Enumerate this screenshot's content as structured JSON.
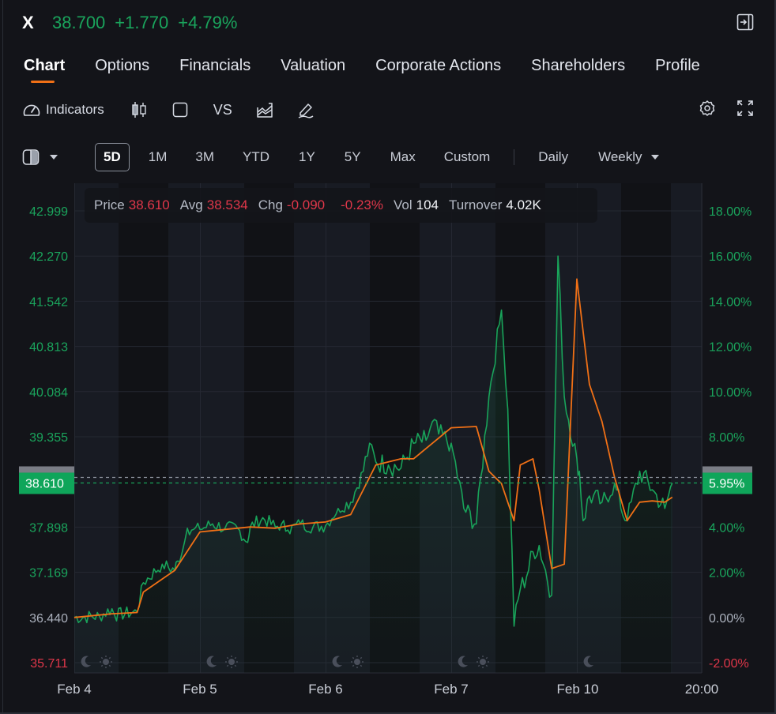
{
  "header": {
    "ticker": "X",
    "price": "38.700",
    "change": "+1.770",
    "change_pct": "+4.79%",
    "quote_color": "#1aa45c"
  },
  "tabs": [
    {
      "label": "Chart",
      "active": true
    },
    {
      "label": "Options",
      "active": false
    },
    {
      "label": "Financials",
      "active": false
    },
    {
      "label": "Valuation",
      "active": false
    },
    {
      "label": "Corporate Actions",
      "active": false
    },
    {
      "label": "Shareholders",
      "active": false
    },
    {
      "label": "Profile",
      "active": false
    }
  ],
  "toolbar": {
    "indicators_label": "Indicators",
    "vs_label": "VS",
    "icons": [
      "gauge-icon",
      "candlestick-icon",
      "square-icon",
      "compare-chart-icon",
      "draw-pen-icon",
      "settings-gear-icon",
      "fullscreen-icon",
      "collapse-panel-icon"
    ]
  },
  "ranges": {
    "items": [
      "5D",
      "1M",
      "3M",
      "YTD",
      "1Y",
      "5Y",
      "Max",
      "Custom"
    ],
    "selected": "5D",
    "interval_daily": "Daily",
    "interval_weekly": "Weekly"
  },
  "info": {
    "price_label": "Price",
    "price": "38.610",
    "avg_label": "Avg",
    "avg": "38.534",
    "chg_label": "Chg",
    "chg": "-0.090",
    "chg_pct": "-0.23%",
    "vol_label": "Vol",
    "vol": "104",
    "turnover_label": "Turnover",
    "turnover": "4.02K"
  },
  "colors": {
    "up": "#1aa45c",
    "down": "#e0374a",
    "neutral": "#aab0bc",
    "price_line": "#19a35a",
    "avg_line": "#f07016",
    "tag_bg": "#0fa55a"
  },
  "chart_data": {
    "type": "line",
    "title": "",
    "xlabel": "",
    "ylabel": "Price",
    "x_ticks": [
      "Feb 4",
      "Feb 5",
      "Feb 6",
      "Feb 7",
      "Feb 10",
      "20:00"
    ],
    "left_axis": {
      "ticks": [
        "42.999",
        "42.270",
        "41.542",
        "40.813",
        "40.084",
        "39.355",
        "37.898",
        "37.169",
        "36.440",
        "35.711"
      ],
      "ylim": [
        35.711,
        42.999
      ],
      "prev_close": 36.44
    },
    "right_axis": {
      "ticks": [
        "18.00%",
        "16.00%",
        "14.00%",
        "12.00%",
        "10.00%",
        "8.00%",
        "4.00%",
        "2.00%",
        "0.00%",
        "-2.00%"
      ],
      "ylim": [
        -2.0,
        18.0
      ]
    },
    "current_price_tag": "38.610",
    "current_pct_tag": "5.95%",
    "grid": true,
    "session_markers": [
      "moon",
      "sun",
      "moon",
      "sun",
      "moon",
      "sun",
      "moon",
      "sun",
      "moon"
    ],
    "series": [
      {
        "name": "Price",
        "x": [
          0,
          0.2,
          0.3,
          0.32,
          0.5,
          0.55,
          0.7,
          0.8,
          0.82,
          0.86,
          0.9,
          0.95,
          1.0,
          1.1,
          1.2,
          1.3,
          1.38,
          1.4,
          1.5,
          1.6,
          1.65,
          1.7,
          1.8,
          1.9,
          2.0,
          2.1,
          2.2,
          2.3,
          2.35,
          2.4,
          2.5,
          2.6,
          2.7,
          2.8,
          2.85,
          2.9,
          3.0,
          3.1,
          3.2,
          3.3,
          3.4,
          3.45,
          3.5,
          3.55,
          3.6,
          3.65,
          3.7,
          3.8,
          3.85,
          3.9,
          4.0,
          4.02,
          4.05,
          4.1,
          4.2,
          4.3,
          4.35,
          4.4,
          4.5,
          4.6,
          4.7,
          4.76
        ],
        "values": [
          36.44,
          36.46,
          36.58,
          36.48,
          36.53,
          37.0,
          37.3,
          37.2,
          37.35,
          37.5,
          37.88,
          37.86,
          37.86,
          37.95,
          37.88,
          37.88,
          37.65,
          37.9,
          38.05,
          37.9,
          37.95,
          37.85,
          37.95,
          37.9,
          37.92,
          38.2,
          38.3,
          38.8,
          39.25,
          38.95,
          38.9,
          38.85,
          39.25,
          39.3,
          39.6,
          39.4,
          39.25,
          38.2,
          37.95,
          40.0,
          41.4,
          39.8,
          36.3,
          36.9,
          37.1,
          37.5,
          37.6,
          36.8,
          42.27,
          40.0,
          39.0,
          38.8,
          38.0,
          38.4,
          38.3,
          38.6,
          38.2,
          38.0,
          38.8,
          38.5,
          38.2,
          38.61
        ]
      },
      {
        "name": "Avg",
        "x": [
          0,
          0.3,
          0.5,
          0.55,
          0.8,
          1.0,
          1.2,
          1.4,
          1.6,
          1.8,
          2.0,
          2.2,
          2.3,
          2.4,
          2.6,
          2.7,
          2.85,
          3.0,
          3.2,
          3.3,
          3.4,
          3.5,
          3.55,
          3.65,
          3.7,
          3.8,
          3.9,
          4.0,
          4.1,
          4.2,
          4.3,
          4.4,
          4.5,
          4.6,
          4.7,
          4.76
        ],
        "values": [
          36.44,
          36.5,
          36.52,
          36.85,
          37.2,
          37.82,
          37.86,
          37.9,
          37.88,
          37.95,
          37.98,
          38.1,
          38.5,
          38.9,
          39.0,
          39.0,
          39.25,
          39.5,
          39.52,
          38.8,
          38.6,
          38.0,
          38.9,
          39.0,
          38.5,
          37.23,
          37.3,
          41.9,
          40.2,
          39.6,
          38.7,
          38.0,
          38.3,
          38.32,
          38.3,
          38.38
        ]
      }
    ]
  }
}
